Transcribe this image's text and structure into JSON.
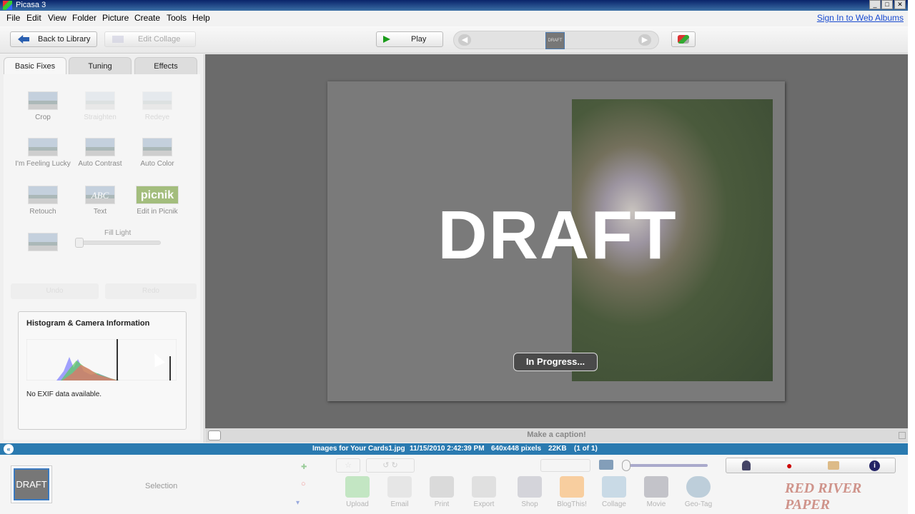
{
  "window": {
    "title": "Picasa 3",
    "min": "_",
    "max": "□",
    "close": "✕"
  },
  "menu": {
    "items": [
      "File",
      "Edit",
      "View",
      "Folder",
      "Picture",
      "Create",
      "Tools",
      "Help"
    ],
    "signin": "Sign In to Web Albums"
  },
  "toolbar": {
    "back_label": "Back to Library",
    "edit_collage_label": "Edit Collage",
    "play_label": "Play",
    "thumb_label": "DRAFT"
  },
  "tabs": [
    "Basic Fixes",
    "Tuning",
    "Effects"
  ],
  "tools": {
    "crop": "Crop",
    "straighten": "Straighten",
    "redeye": "Redeye",
    "lucky": "I'm Feeling Lucky",
    "contrast": "Auto Contrast",
    "color": "Auto Color",
    "retouch": "Retouch",
    "text": "Text",
    "picnik": "Edit in Picnik",
    "picnik_logo": "picnik",
    "text_logo": "ABC",
    "fill_light": "Fill Light",
    "undo": "Undo",
    "redo": "Redo"
  },
  "histogram": {
    "title": "Histogram & Camera Information",
    "exif": "No EXIF data available."
  },
  "main": {
    "watermark": "DRAFT",
    "progress": "In Progress...",
    "caption": "Make a caption!"
  },
  "status": {
    "filename": "Images for Your Cards1.jpg",
    "date": "11/15/2010 2:42:39 PM",
    "dims": "640x448 pixels",
    "size": "22KB",
    "count": "(1 of 1)"
  },
  "tray": {
    "thumb_label": "DRAFT",
    "selection": "Selection",
    "buttons": [
      "Upload",
      "Email",
      "Print",
      "Export",
      "Shop",
      "BlogThis!",
      "Collage",
      "Movie",
      "Geo-Tag"
    ],
    "brand": "RED RIVER PAPER"
  },
  "colors": {
    "statusbar": "#2a7ab0",
    "link": "#1a4bd0",
    "play": "#1a9b1a"
  }
}
